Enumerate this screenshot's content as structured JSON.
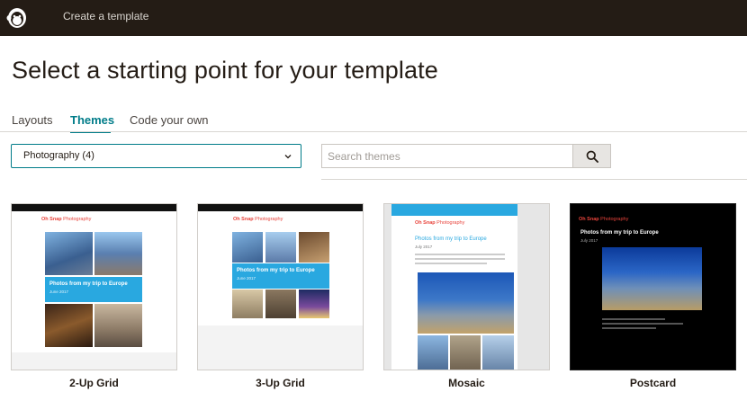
{
  "topbar": {
    "title": "Create a template",
    "background": "#241c15"
  },
  "page": {
    "title": "Select a starting point for your template"
  },
  "tabs": [
    {
      "label": "Layouts",
      "active": false
    },
    {
      "label": "Themes",
      "active": true
    },
    {
      "label": "Code your own",
      "active": false
    }
  ],
  "filters": {
    "category_select": {
      "value": "Photography (4)"
    },
    "search": {
      "placeholder": "Search themes",
      "button_icon": "search-icon"
    }
  },
  "themes": [
    {
      "label": "2-Up Grid",
      "preview": {
        "brand": "Oh Snap",
        "brand_suffix": "Photography",
        "headline": "Photos from my trip to Europe",
        "date": "June 2017"
      }
    },
    {
      "label": "3-Up Grid",
      "preview": {
        "brand": "Oh Snap",
        "brand_suffix": "Photography",
        "headline": "Photos from my trip to Europe",
        "date": "June 2017"
      }
    },
    {
      "label": "Mosaic",
      "preview": {
        "brand": "Oh Snap",
        "brand_suffix": "Photography",
        "headline": "Photos from my trip to Europe",
        "date": "July 2017"
      }
    },
    {
      "label": "Postcard",
      "preview": {
        "brand": "Oh Snap",
        "brand_suffix": "Photography",
        "headline": "Photos from my trip to Europe",
        "date": "July 2017"
      }
    }
  ],
  "colors": {
    "accent": "#007c89",
    "brand_red": "#e8433b",
    "banner_blue": "#29a8e0"
  }
}
